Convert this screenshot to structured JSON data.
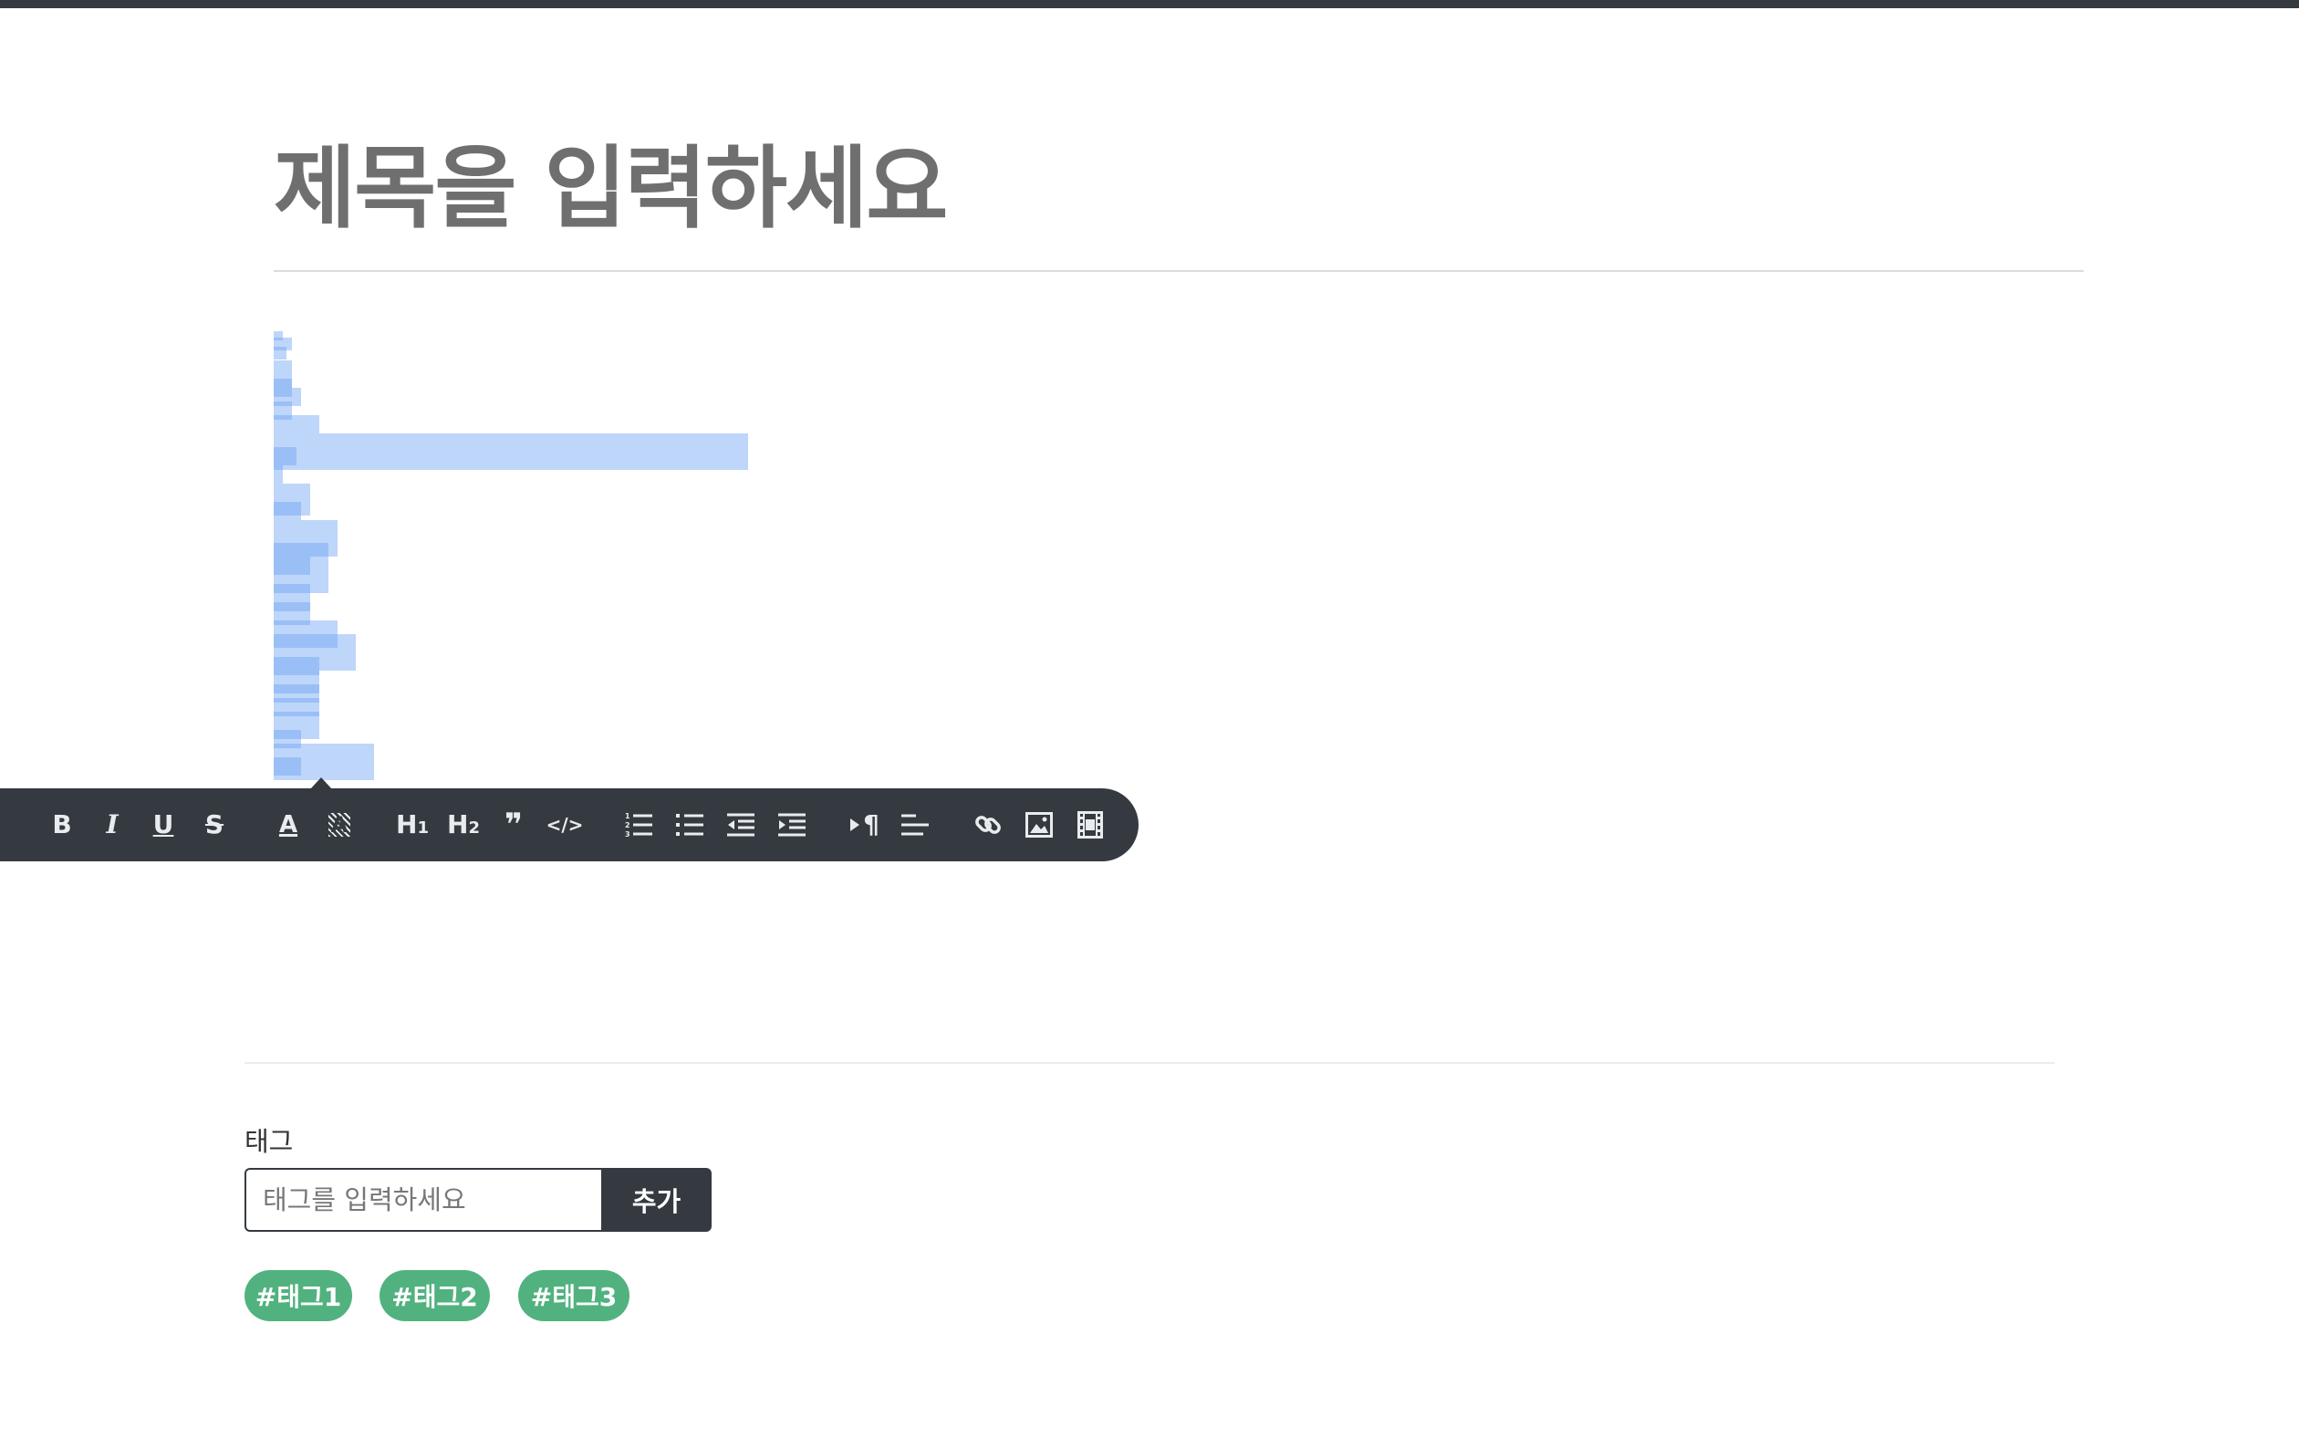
{
  "post": {
    "title_placeholder": "제목을 입력하세요"
  },
  "toolbar": {
    "buttons": [
      {
        "name": "bold",
        "icon": "bold-icon",
        "glyph": "B"
      },
      {
        "name": "italic",
        "icon": "italic-icon",
        "glyph": "I"
      },
      {
        "name": "underline",
        "icon": "underline-icon",
        "glyph": "U"
      },
      {
        "name": "strikethrough",
        "icon": "strikethrough-icon",
        "glyph": "S"
      },
      {
        "name": "font-color",
        "icon": "font-color-icon",
        "glyph": "A"
      },
      {
        "name": "highlight",
        "icon": "highlight-icon",
        "glyph": "A"
      },
      {
        "name": "heading-1",
        "icon": "heading-1-icon",
        "glyph": "H",
        "sub": "1"
      },
      {
        "name": "heading-2",
        "icon": "heading-2-icon",
        "glyph": "H",
        "sub": "2"
      },
      {
        "name": "blockquote",
        "icon": "quote-icon",
        "glyph": "❞"
      },
      {
        "name": "code",
        "icon": "code-icon",
        "glyph": "</>"
      },
      {
        "name": "ordered-list",
        "icon": "ordered-list-icon"
      },
      {
        "name": "bullet-list",
        "icon": "bullet-list-icon"
      },
      {
        "name": "outdent",
        "icon": "outdent-icon"
      },
      {
        "name": "indent",
        "icon": "indent-icon"
      },
      {
        "name": "paragraph-direction",
        "icon": "paragraph-icon",
        "glyph": "¶"
      },
      {
        "name": "align",
        "icon": "align-left-icon"
      },
      {
        "name": "link",
        "icon": "link-icon"
      },
      {
        "name": "image",
        "icon": "image-icon"
      },
      {
        "name": "video",
        "icon": "video-icon"
      }
    ],
    "colors": {
      "background": "#343a40",
      "icon": "#e9ecef"
    }
  },
  "tags": {
    "label": "태그",
    "input_placeholder": "태그를 입력하세요",
    "add_button_label": "추가",
    "items": [
      "#태그1",
      "#태그2",
      "#태그3"
    ],
    "colors": {
      "chip": "#51b27f",
      "button": "#343a40"
    }
  }
}
